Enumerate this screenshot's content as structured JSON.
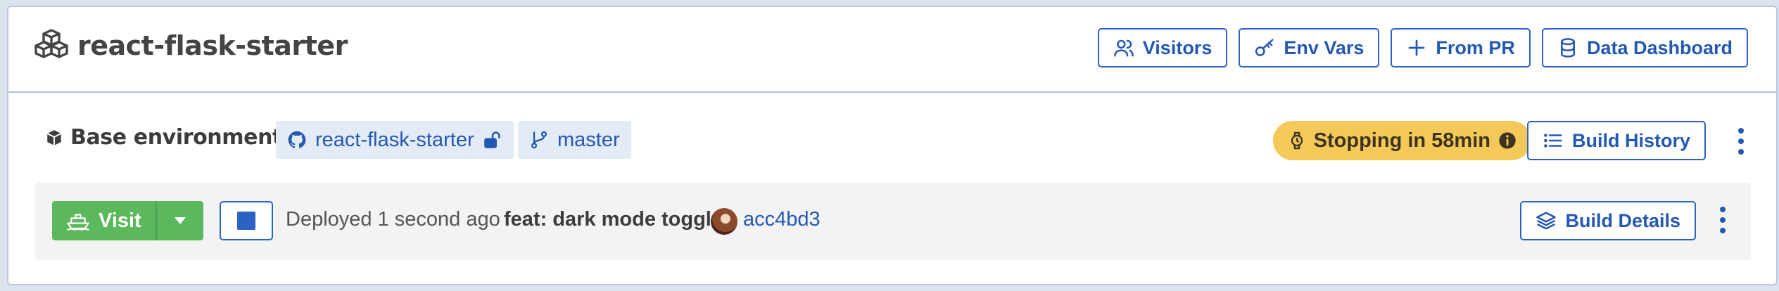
{
  "header": {
    "title": "react-flask-starter",
    "actions": [
      {
        "label": "Visitors",
        "icon": "users-icon"
      },
      {
        "label": "Env Vars",
        "icon": "key-icon"
      },
      {
        "label": "From PR",
        "icon": "plus-icon"
      },
      {
        "label": "Data Dashboard",
        "icon": "database-icon"
      }
    ]
  },
  "environment": {
    "label": "Base environment",
    "repo": "react-flask-starter",
    "branch": "master",
    "status": "Stopping in 58min",
    "build_history_label": "Build History"
  },
  "deployment": {
    "visit_label": "Visit",
    "deployed_text": "Deployed 1 second ago",
    "commit_message": "feat: dark mode toggle",
    "commit_hash": "acc4bd3",
    "build_details_label": "Build Details"
  },
  "colors": {
    "accent": "#2358b3",
    "visit_green": "#5cb85c",
    "status_yellow": "#f4c95a",
    "row_bg": "#f3f3f3",
    "chip_bg": "#e3ebf7"
  }
}
